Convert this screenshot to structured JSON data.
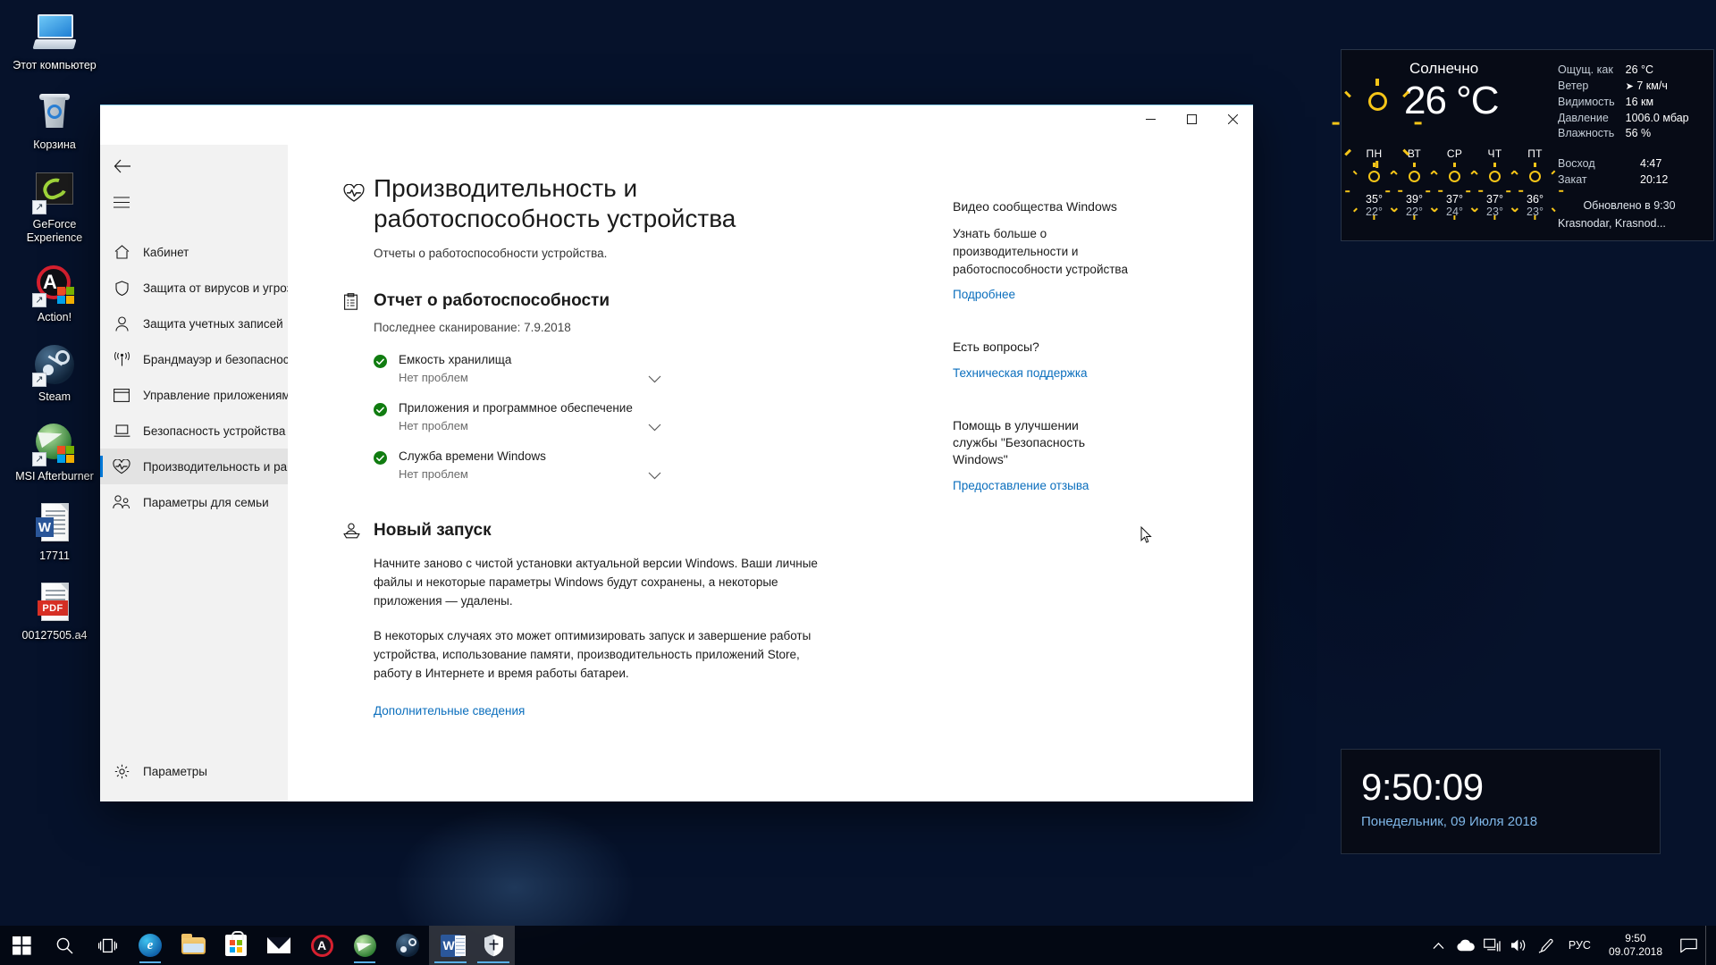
{
  "desktop": {
    "icons": [
      {
        "label": "Этот компьютер",
        "icon": "this-pc-icon"
      },
      {
        "label": "Корзина",
        "icon": "recycle-bin-icon"
      },
      {
        "label": "GeForce Experience",
        "icon": "geforce-experience-icon"
      },
      {
        "label": "Action!",
        "icon": "action-recorder-icon"
      },
      {
        "label": "Steam",
        "icon": "steam-icon"
      },
      {
        "label": "MSI Afterburner",
        "icon": "msi-afterburner-icon"
      },
      {
        "label": "17711",
        "icon": "word-document-icon"
      },
      {
        "label": "00127505.a4",
        "icon": "pdf-document-icon"
      }
    ]
  },
  "weather_gadget": {
    "condition": "Солнечно",
    "temperature": "26 °C",
    "icon": "sun-icon",
    "details": [
      {
        "key": "Ощущ. как",
        "value": "26 °C"
      },
      {
        "key": "Ветер",
        "value": "7 км/ч"
      },
      {
        "key": "Видимость",
        "value": "16 км"
      },
      {
        "key": "Давление",
        "value": "1006.0 мбар"
      },
      {
        "key": "Влажность",
        "value": "56 %"
      }
    ],
    "wind_arrow": "➤",
    "sun_times": [
      {
        "key": "Восход",
        "value": "4:47"
      },
      {
        "key": "Закат",
        "value": "20:12"
      }
    ],
    "forecast": [
      {
        "day": "ПН",
        "high": "35°",
        "low": "22°",
        "icon": "sun-icon"
      },
      {
        "day": "ВТ",
        "high": "39°",
        "low": "22°",
        "icon": "sun-icon"
      },
      {
        "day": "СР",
        "high": "37°",
        "low": "24°",
        "icon": "sun-icon"
      },
      {
        "day": "ЧТ",
        "high": "37°",
        "low": "23°",
        "icon": "sun-icon"
      },
      {
        "day": "ПТ",
        "high": "36°",
        "low": "23°",
        "icon": "sun-icon"
      }
    ],
    "updated": "Обновлено в 9:30",
    "location": "Krasnodar, Krasnod..."
  },
  "clock_gadget": {
    "time": "9:50:09",
    "date": "Понедельник, 09 Июля 2018"
  },
  "window": {
    "controls": {
      "minimize": "minimize-icon",
      "maximize": "maximize-icon",
      "close": "close-icon"
    }
  },
  "sidebar": {
    "back": "back-arrow-icon",
    "menu": "hamburger-menu-icon",
    "items": [
      {
        "label": "Кабинет",
        "icon": "home-icon"
      },
      {
        "label": "Защита от вирусов и угроз",
        "icon": "shield-icon"
      },
      {
        "label": "Защита учетных записей",
        "icon": "person-icon"
      },
      {
        "label": "Брандмауэр и безопасность сети",
        "icon": "wifi-icon"
      },
      {
        "label": "Управление приложениями/браузером",
        "icon": "window-icon"
      },
      {
        "label": "Безопасность устройства",
        "icon": "laptop-icon"
      },
      {
        "label": "Производительность и работоспособность устройства",
        "icon": "heart-pulse-icon"
      },
      {
        "label": "Параметры для семьи",
        "icon": "family-icon"
      }
    ],
    "active_index": 6,
    "settings": {
      "label": "Параметры",
      "icon": "gear-icon"
    }
  },
  "main": {
    "title": "Производительность и работоспособность устройства",
    "title_icon": "heart-pulse-icon",
    "subtitle": "Отчеты о работоспособности устройства.",
    "health_report": {
      "title": "Отчет о работоспособности",
      "icon": "clipboard-icon",
      "last_scan": "Последнее сканирование: 7.9.2018",
      "items": [
        {
          "name": "Емкость хранилища",
          "status": "Нет проблем",
          "state_icon": "green-check-icon",
          "expand_icon": "chevron-down-icon"
        },
        {
          "name": "Приложения и программное обеспечение",
          "status": "Нет проблем",
          "state_icon": "green-check-icon",
          "expand_icon": "chevron-down-icon"
        },
        {
          "name": "Служба времени Windows",
          "status": "Нет проблем",
          "state_icon": "green-check-icon",
          "expand_icon": "chevron-down-icon"
        }
      ]
    },
    "fresh_start": {
      "title": "Новый запуск",
      "icon": "fresh-start-icon",
      "paragraph1": "Начните заново с чистой установки актуальной версии Windows. Ваши личные файлы и некоторые параметры Windows будут сохранены, а некоторые приложения — удалены.",
      "paragraph2": "В некоторых случаях это может оптимизировать запуск и завершение работы устройства, использование памяти, производительность приложений Store, работу в Интернете и время работы батареи.",
      "more_link": "Дополнительные сведения"
    }
  },
  "right_column": {
    "blocks": [
      {
        "title": "Видео сообщества Windows",
        "text": "Узнать больше о производительности и работоспособности устройства",
        "link": "Подробнее"
      },
      {
        "title": "Есть вопросы?",
        "text": "",
        "link": "Техническая поддержка"
      },
      {
        "title": "Помощь в улучшении службы \"Безопасность Windows\"",
        "text": "",
        "link": "Предоставление отзыва"
      }
    ]
  },
  "taskbar": {
    "start": "windows-start-icon",
    "search": "search-icon",
    "task_view": "task-view-icon",
    "apps": [
      {
        "name": "edge-icon",
        "label": "e",
        "running": true,
        "active": false
      },
      {
        "name": "file-explorer-icon",
        "label": "",
        "running": false,
        "active": false
      },
      {
        "name": "microsoft-store-icon",
        "label": "",
        "running": false,
        "active": false
      },
      {
        "name": "mail-icon",
        "label": "",
        "running": false,
        "active": false
      },
      {
        "name": "action-recorder-icon",
        "label": "A",
        "running": false,
        "active": false
      },
      {
        "name": "msi-afterburner-icon",
        "label": "",
        "running": true,
        "active": false
      },
      {
        "name": "steam-icon",
        "label": "",
        "running": false,
        "active": false
      },
      {
        "name": "word-icon",
        "label": "W",
        "running": false,
        "active": true
      },
      {
        "name": "windows-security-icon",
        "label": "",
        "running": false,
        "active": true
      }
    ],
    "tray": {
      "chevron": "chevron-up-icon",
      "onedrive": "onedrive-cloud-icon",
      "network": "network-icon",
      "volume": "volume-icon",
      "pen": "pen-icon",
      "language": "РУС",
      "time": "9:50",
      "date": "09.07.2018",
      "action_center": "action-center-icon"
    }
  },
  "colors": {
    "accent": "#0078d7",
    "link": "#0a6ebd",
    "success": "#107c10",
    "sidebar_bg": "#f2f2f2"
  }
}
